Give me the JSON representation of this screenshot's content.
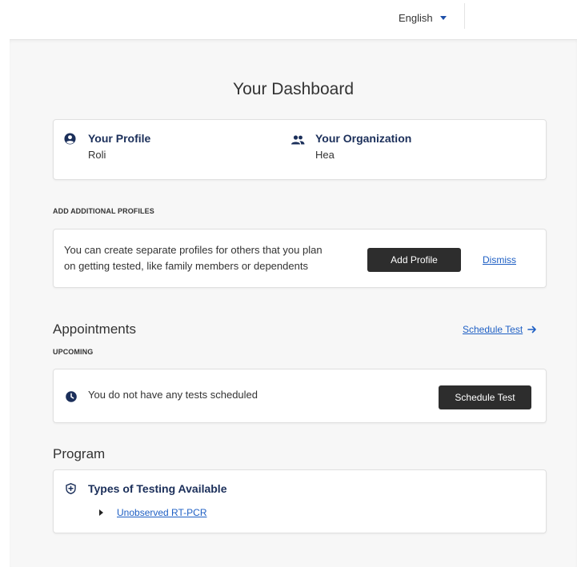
{
  "header": {
    "language": "English"
  },
  "dashboard": {
    "title": "Your Dashboard",
    "profile": {
      "label": "Your Profile",
      "value": "Roli"
    },
    "organization": {
      "label": "Your Organization",
      "value": "Hea"
    }
  },
  "add_profiles": {
    "section_label": "ADD ADDITIONAL PROFILES",
    "description_line1": "You can create separate profiles for others that you plan",
    "description_line2": "on getting tested, like family members or dependents",
    "add_button": "Add Profile",
    "dismiss_link": "Dismiss"
  },
  "appointments": {
    "heading": "Appointments",
    "schedule_link": "Schedule Test",
    "upcoming_label": "UPCOMING",
    "empty_message": "You do not have any tests scheduled",
    "schedule_button": "Schedule Test"
  },
  "program": {
    "heading": "Program",
    "testing_title": "Types of Testing Available",
    "testing_items": [
      "Unobserved RT-PCR"
    ]
  },
  "colors": {
    "navy": "#1b2f5a",
    "link": "#1e5fc4",
    "button": "#2d2d2d",
    "background": "#f7f7f7"
  },
  "icons": {
    "profile": "user-circle-icon",
    "organization": "group-icon",
    "clock": "clock-icon",
    "shield": "shield-plus-icon",
    "arrow": "arrow-right-icon",
    "caret": "caret-down-icon",
    "expand": "caret-right-icon"
  }
}
